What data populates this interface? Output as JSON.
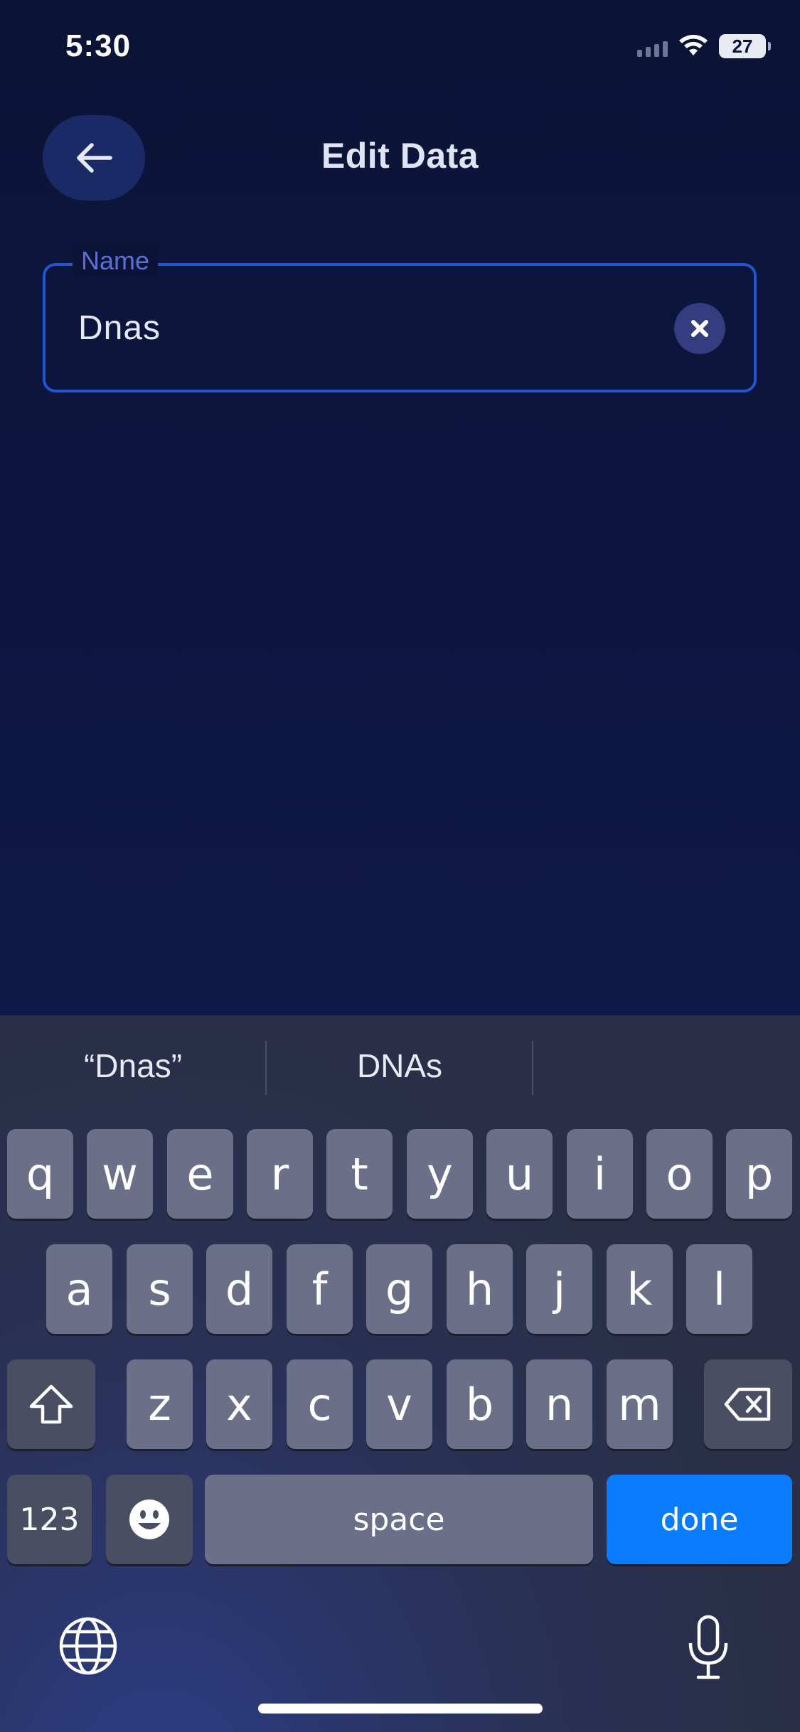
{
  "status_bar": {
    "time": "5:30",
    "battery": "27"
  },
  "header": {
    "title": "Edit Data",
    "back_icon": "arrow-left-icon"
  },
  "form": {
    "name_field": {
      "label": "Name",
      "value": "Dnas",
      "clear_icon": "close-icon"
    }
  },
  "keyboard": {
    "suggestions": [
      "“Dnas”",
      "DNAs",
      ""
    ],
    "row1": [
      "q",
      "w",
      "e",
      "r",
      "t",
      "y",
      "u",
      "i",
      "o",
      "p"
    ],
    "row2": [
      "a",
      "s",
      "d",
      "f",
      "g",
      "h",
      "j",
      "k",
      "l"
    ],
    "row3": [
      "z",
      "x",
      "c",
      "v",
      "b",
      "n",
      "m"
    ],
    "numbers_key": "123",
    "space_key": "space",
    "done_key": "done",
    "icons": {
      "shift": "shift-icon",
      "delete": "backspace-icon",
      "emoji": "emoji-icon",
      "globe": "globe-icon",
      "mic": "microphone-icon"
    }
  },
  "colors": {
    "background": "#0b1436",
    "field_border": "#2553d6",
    "done_key": "#0a7cff"
  }
}
